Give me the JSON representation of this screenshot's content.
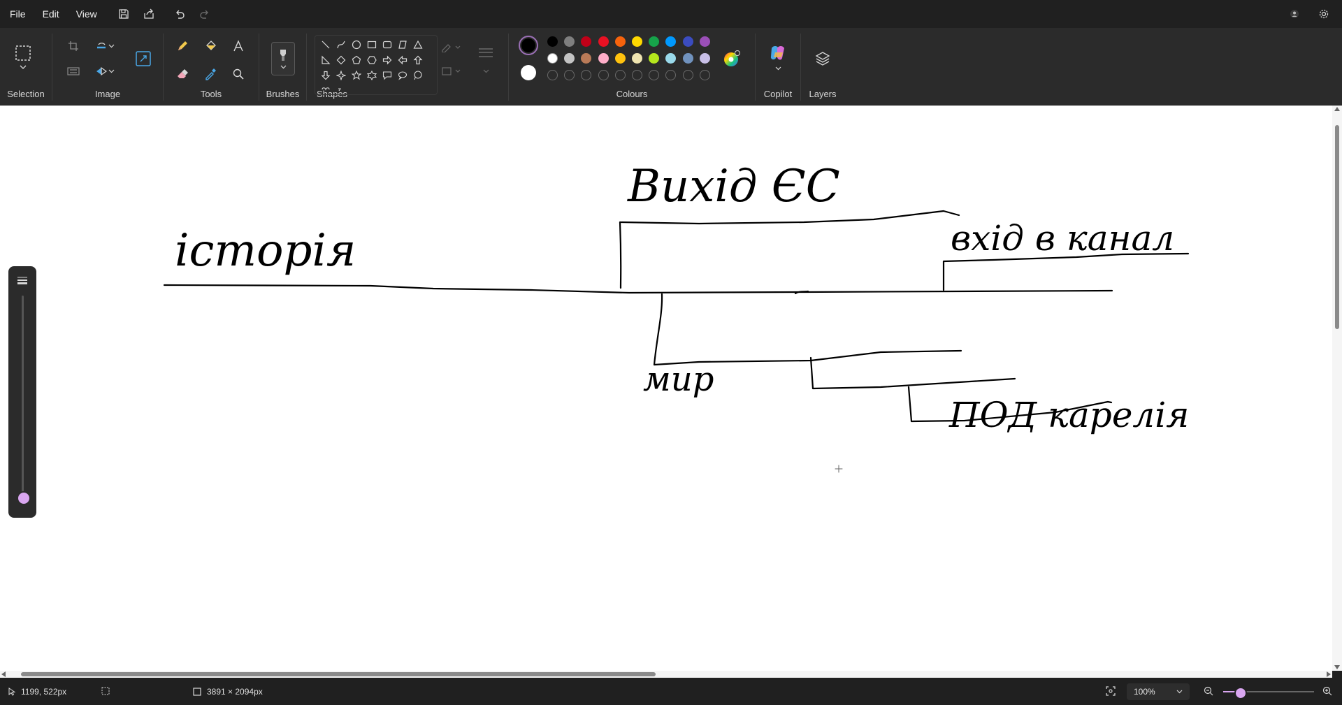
{
  "menu": {
    "file": "File",
    "edit": "Edit",
    "view": "View"
  },
  "ribbon": {
    "groups": {
      "selection": "Selection",
      "image": "Image",
      "tools": "Tools",
      "brushes": "Brushes",
      "shapes": "Shapes",
      "colours": "Colours",
      "copilot": "Copilot",
      "layers": "Layers"
    }
  },
  "colours": {
    "primary": "#000000",
    "secondary": "#ffffff",
    "row1": [
      "#000000",
      "#7f7f7f",
      "#c00018",
      "#e81123",
      "#f7630c",
      "#ffd800",
      "#16a34a",
      "#0099ff",
      "#3b4cc0",
      "#9b4fb8"
    ],
    "row2": [
      "#ffffff",
      "#c3c3c3",
      "#b97a57",
      "#ffaec9",
      "#ffc20e",
      "#efe4b0",
      "#b5e61d",
      "#99d9ea",
      "#7092be",
      "#c8bfe7"
    ]
  },
  "canvas": {
    "labels": {
      "history": "історія",
      "exit_eu": "Вихід ЄС",
      "exit_in_kanal": "вхід в канал",
      "mir": "мир",
      "ind_karelia": "ПОД карелія"
    }
  },
  "status": {
    "cursor_pos": "1199, 522px",
    "canvas_size": "3891 × 2094px",
    "zoom": "100%"
  }
}
